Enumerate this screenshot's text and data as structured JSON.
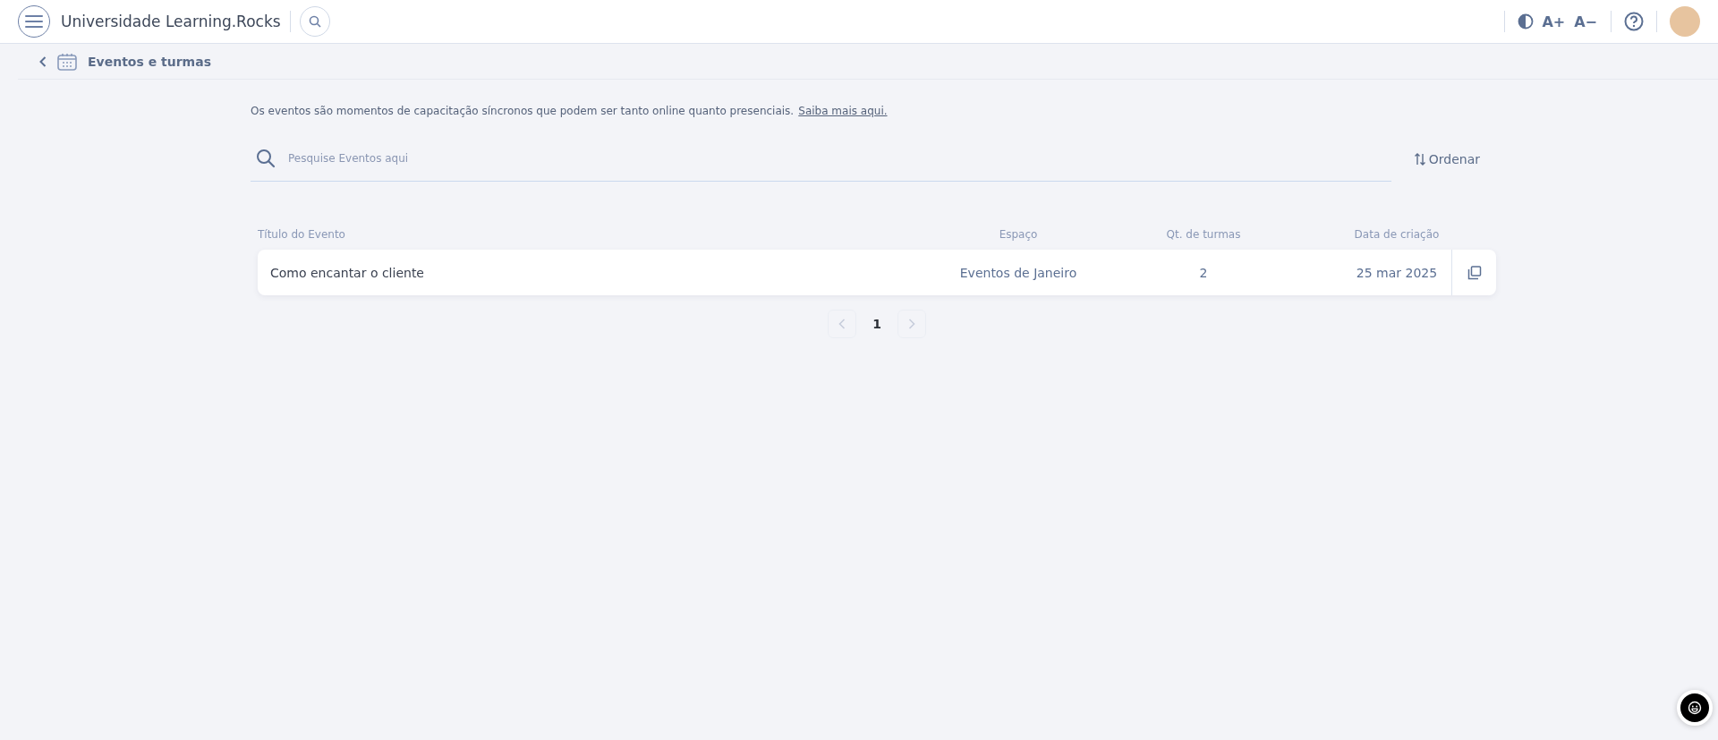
{
  "header": {
    "title": "Universidade Learning.Rocks",
    "font_increase": "A+",
    "font_decrease": "A−"
  },
  "breadcrumb": {
    "title": "Eventos e turmas"
  },
  "intro": {
    "text": "Os eventos são momentos de capacitação síncronos que podem ser tanto online quanto presenciais.",
    "link": "Saiba mais aqui."
  },
  "search": {
    "placeholder": "Pesquise Eventos aqui"
  },
  "sort": {
    "label": "Ordenar"
  },
  "table": {
    "columns": [
      "Título do Evento",
      "Espaço",
      "Qt. de turmas",
      "Data de criação"
    ],
    "rows": [
      {
        "title": "Como encantar o cliente",
        "space": "Eventos de Janeiro",
        "classes": "2",
        "created": "25 mar 2025"
      }
    ]
  },
  "pagination": {
    "prev_disabled": true,
    "next_disabled": true,
    "pages": [
      {
        "label": "1",
        "selected": true
      }
    ]
  }
}
